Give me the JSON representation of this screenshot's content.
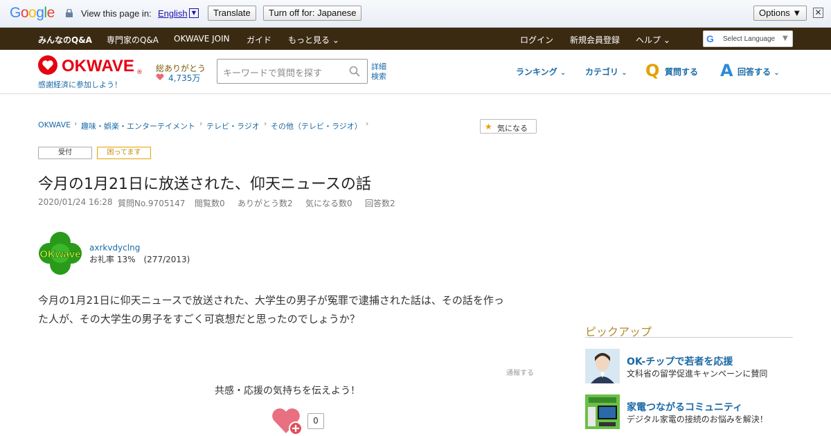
{
  "translate_bar": {
    "logo": "Google",
    "view_text": "View this page in:",
    "language": "English",
    "translate_btn": "Translate",
    "turn_off_btn": "Turn off for: Japanese",
    "options_btn": "Options ▼",
    "close": "✕"
  },
  "topnav": {
    "items": [
      "みんなのQ&A",
      "専門家のQ&A",
      "OKWAVE JOIN",
      "ガイド",
      "もっと見る"
    ],
    "right": [
      "ログイン",
      "新規会員登録",
      "ヘルプ"
    ],
    "select_language": "Select Language"
  },
  "header": {
    "logo": "OKWAVE",
    "tagline": "感謝経済に参加しよう！",
    "thanks_label": "総ありがとう",
    "thanks_count": "4,735万",
    "search_placeholder": "キーワードで質問を探す",
    "advanced_1": "詳細",
    "advanced_2": "検索",
    "ranking": "ランキング",
    "category": "カテゴリ",
    "ask": "質問する",
    "answer": "回答する"
  },
  "breadcrumb": [
    "OKWAVE",
    "趣味・娯楽・エンターテイメント",
    "テレビ・ラジオ",
    "その他（テレビ・ラジオ）"
  ],
  "follow_btn": "気になる",
  "tags": [
    "受付",
    "困ってます"
  ],
  "question": {
    "title": "今月の1月21日に放送された、仰天ニュースの話",
    "date": "2020/01/24 16:28",
    "number": "質問No.9705147",
    "views": "閲覧数0",
    "thanks": "ありがとう数2",
    "follows": "気になる数0",
    "answers": "回答数2",
    "body_line1": "今月の1月21日に仰天ニュースで放送された、大学生の男子が冤罪で逮捕された話は、その話を作っ",
    "body_line2": "た人が、その大学生の男子をすごく可哀想だと思ったのでしょうか？",
    "report": "通報する",
    "support_text": "共感・応援の気持ちを伝えよう！",
    "support_count": "0"
  },
  "user": {
    "name": "axrkvdyclng",
    "rate": "お礼率 13%　(277/2013)",
    "avatar_text": "OKwave"
  },
  "pickup": {
    "heading": "ピックアップ",
    "items": [
      {
        "title": "OK-チップで若者を応援",
        "desc": "文科省の留学促進キャンペーンに賛同"
      },
      {
        "title": "家電つながるコミュニティ",
        "desc": "デジタル家電の接続のお悩みを解決！"
      }
    ]
  },
  "colors": {
    "brand_red": "#e60012",
    "link_blue": "#1a6aa6",
    "nav_brown": "#3b2a12",
    "qa_yellow": "#e6a000",
    "qa_blue": "#2e8ad8"
  }
}
